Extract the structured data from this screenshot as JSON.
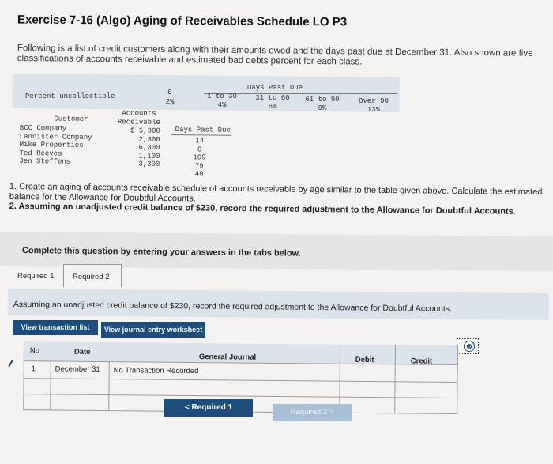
{
  "title": "Exercise 7-16 (Algo) Aging of Receivables Schedule LO P3",
  "intro": "Following is a list of credit customers along with their amounts owed and the days past due at December 31. Also shown are five classifications of accounts receivable and estimated bad debts percent for each class.",
  "pct_table": {
    "row_label": "Percent uncollectible",
    "group_header": "Days Past Due",
    "columns": [
      {
        "label": "0",
        "pct": "2%"
      },
      {
        "label": "1 to 30",
        "pct": "4%"
      },
      {
        "label": "31 to 60",
        "pct": "6%"
      },
      {
        "label": "61 to 90",
        "pct": "9%"
      },
      {
        "label": "Over 90",
        "pct": "13%"
      }
    ]
  },
  "customer_table": {
    "headers": {
      "customer": "Customer",
      "ar_line1": "Accounts",
      "ar_line2": "Receivable",
      "dpd": "Days Past Due"
    },
    "rows": [
      {
        "customer": "BCC Company",
        "ar": "$ 5,300",
        "dpd": "14"
      },
      {
        "customer": "Lannister Company",
        "ar": "2,300",
        "dpd": "0"
      },
      {
        "customer": "Mike Properties",
        "ar": "6,300",
        "dpd": "109"
      },
      {
        "customer": "Ted Reeves",
        "ar": "1,100",
        "dpd": "79"
      },
      {
        "customer": "Jen Steffens",
        "ar": "3,300",
        "dpd": "40"
      }
    ]
  },
  "questions": {
    "q1": "1. Create an aging of accounts receivable schedule of accounts receivable by age similar to the table given above. Calculate the estimated balance for the Allowance for Doubtful Accounts.",
    "q2": "2. Assuming an unadjusted credit balance of $230, record the required adjustment to the Allowance for Doubtful Accounts."
  },
  "complete_text": "Complete this question by entering your answers in the tabs below.",
  "tabs": {
    "req1": "Required 1",
    "req2": "Required 2"
  },
  "assume_text": "Assuming an unadjusted credit balance of $230, record the required adjustment to the Allowance for Doubtful Accounts.",
  "buttons": {
    "view_transaction": "View transaction list",
    "view_journal": "View journal entry worksheet",
    "close": "⊗",
    "nav_req1": "< Required 1",
    "nav_req2": "Required 2 >"
  },
  "journal": {
    "headers": {
      "no": "No",
      "date": "Date",
      "gj": "General Journal",
      "debit": "Debit",
      "credit": "Credit"
    },
    "row": {
      "no": "1",
      "date": "December 31",
      "desc": "No Transaction Recorded"
    }
  }
}
